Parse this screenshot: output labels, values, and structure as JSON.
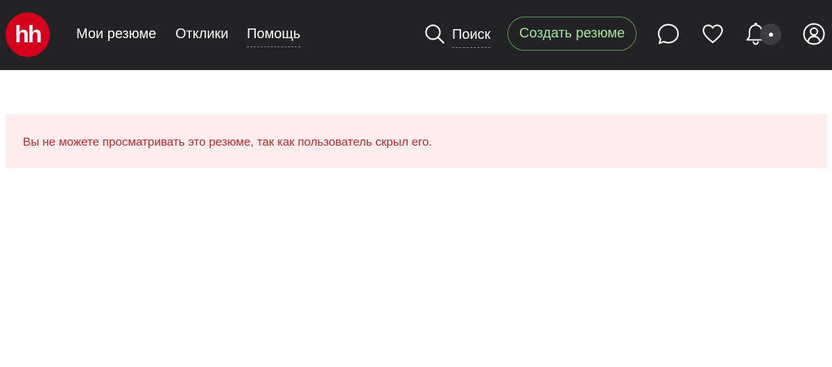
{
  "header": {
    "logo_text": "hh",
    "nav": [
      {
        "label": "Мои резюме"
      },
      {
        "label": "Отклики"
      },
      {
        "label": "Помощь"
      }
    ],
    "search_label": "Поиск",
    "create_resume_label": "Создать резюме",
    "icons": [
      "search-icon",
      "chat-icon",
      "heart-icon",
      "bell-icon",
      "notification-dot-icon",
      "user-profile-icon"
    ]
  },
  "alert": {
    "message": "Вы не можете просматривать это резюме, так как пользователь скрыл его."
  },
  "colors": {
    "header_bg": "#232325",
    "logo_red": "#d6001c",
    "create_button_text": "#a6e29c",
    "create_button_border": "#5d9c5a",
    "alert_bg": "#fdeeee",
    "alert_text": "#c1292e"
  }
}
